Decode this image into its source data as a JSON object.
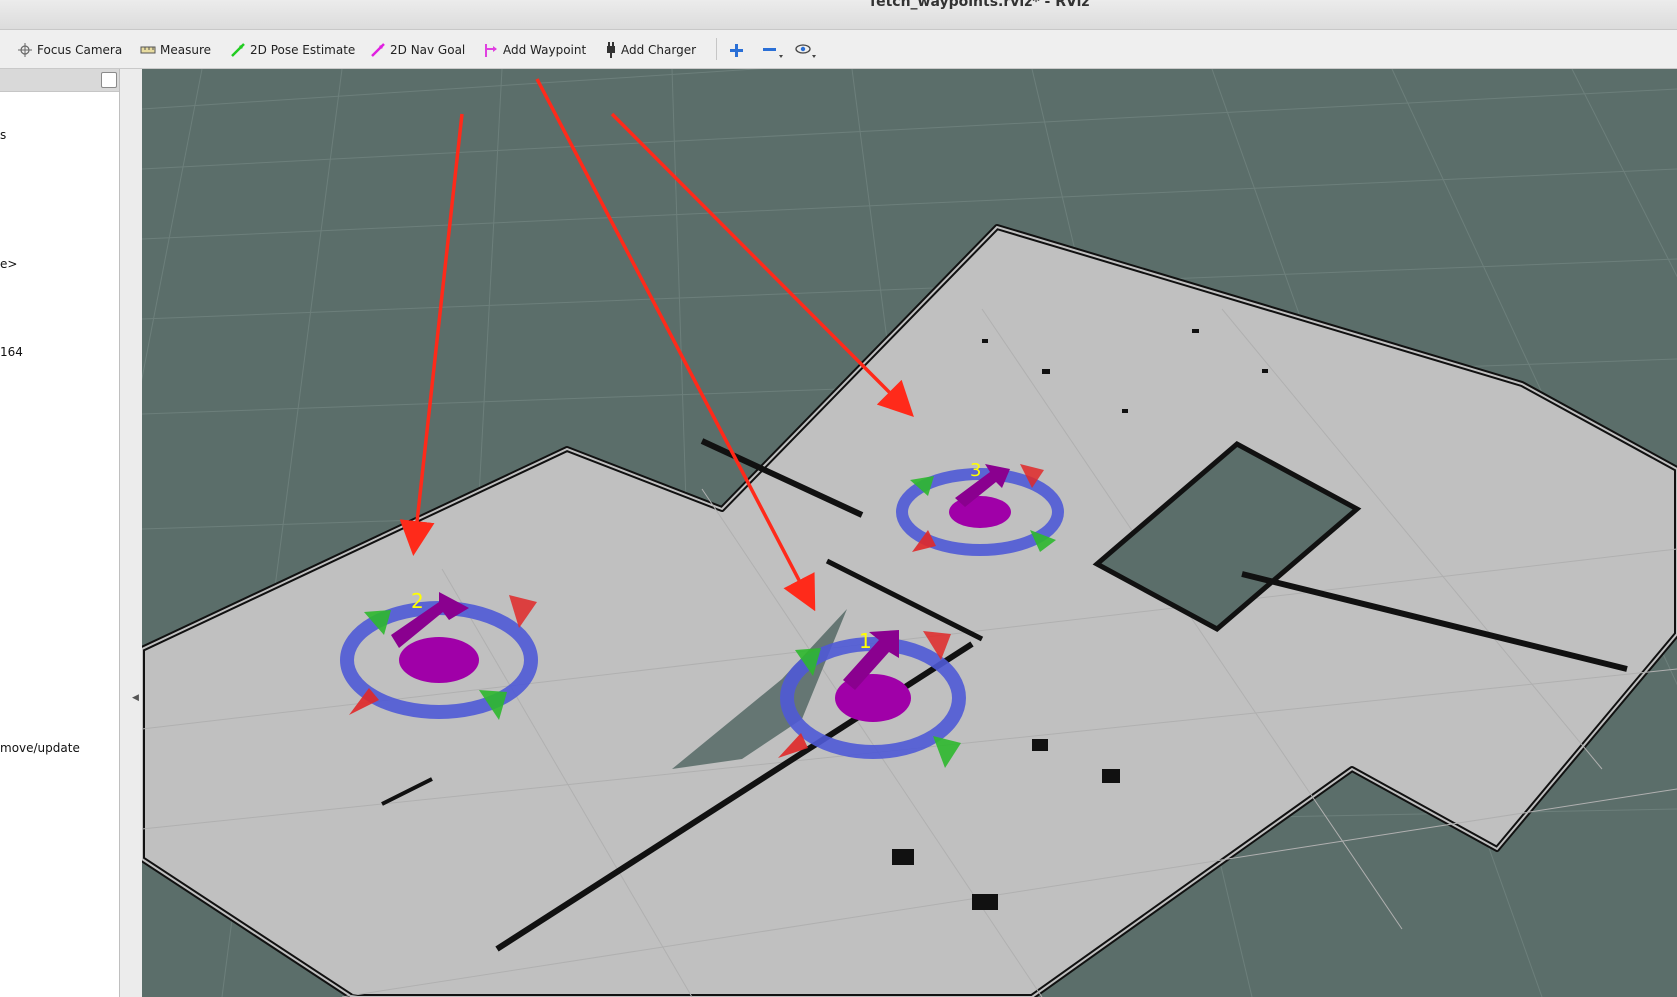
{
  "window": {
    "title": "fetch_waypoints.rviz* - RViz"
  },
  "toolbar": {
    "focus_camera": "Focus Camera",
    "measure": "Measure",
    "pose_estimate": "2D Pose Estimate",
    "nav_goal": "2D Nav Goal",
    "add_waypoint": "Add Waypoint",
    "add_charger": "Add Charger"
  },
  "side_panel": {
    "partial_texts": [
      "s",
      "e>",
      "164",
      "move/update"
    ]
  },
  "waypoints": [
    {
      "label": "1"
    },
    {
      "label": "2"
    },
    {
      "label": "3"
    }
  ],
  "colors": {
    "background": "#5b6e6a",
    "map_free": "#c0c0c0",
    "wall": "#111111",
    "ring": "#4f5ad6",
    "marker": "#a000a8",
    "label": "#ffff00",
    "annotation_arrow": "#ff2a1a"
  }
}
